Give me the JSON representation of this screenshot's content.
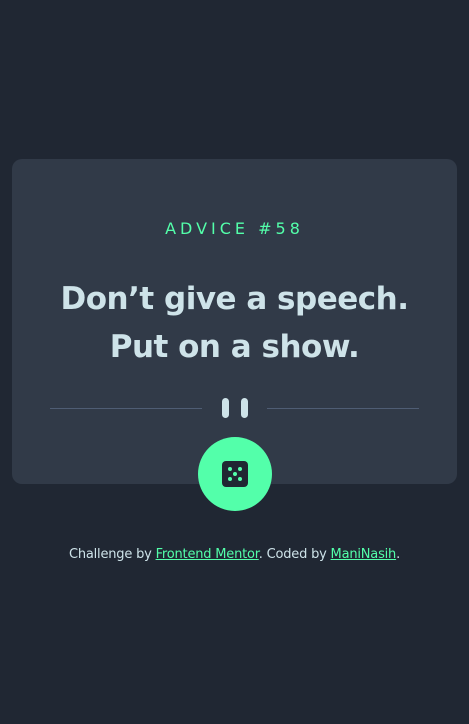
{
  "advice": {
    "id_label": "ADVICE #58",
    "line1": "Don’t give a speech.",
    "line2": "Put on a show."
  },
  "controls": {
    "dice_icon": "dice-icon",
    "pause_icon": "pause-icon"
  },
  "footer": {
    "prefix": "Challenge by ",
    "link1": "Frontend Mentor",
    "middle": ". Coded by ",
    "link2": "ManiNasih",
    "suffix": "."
  },
  "colors": {
    "background": "#202733",
    "card": "#313A48",
    "accent": "#53FFAA",
    "text": "#CEE3E9",
    "divider": "#4F5D74"
  }
}
